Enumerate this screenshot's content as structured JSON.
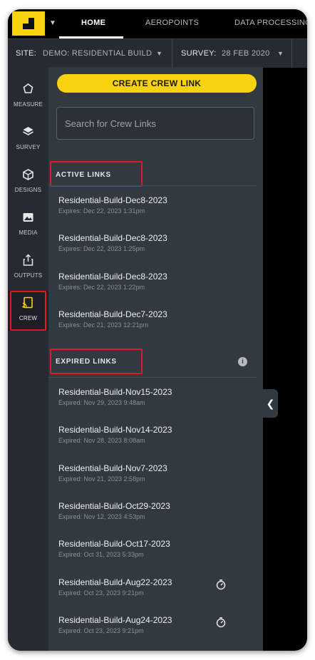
{
  "nav": {
    "tabs": [
      {
        "label": "HOME"
      },
      {
        "label": "AEROPOINTS"
      },
      {
        "label": "DATA PROCESSING"
      }
    ]
  },
  "sitebar": {
    "site_label": "SITE:",
    "site_value": "DEMO: RESIDENTIAL BUILD",
    "survey_label": "SURVEY:",
    "survey_value": "28 FEB 2020"
  },
  "rail": {
    "items": [
      {
        "label": "MEASURE",
        "icon": "measure-icon"
      },
      {
        "label": "SURVEY",
        "icon": "layers-icon"
      },
      {
        "label": "DESIGNS",
        "icon": "cube-icon"
      },
      {
        "label": "MEDIA",
        "icon": "image-icon"
      },
      {
        "label": "OUTPUTS",
        "icon": "share-icon"
      },
      {
        "label": "CREW",
        "icon": "crew-link-icon"
      }
    ],
    "active": "CREW"
  },
  "panel": {
    "create_button": "CREATE CREW LINK",
    "search_placeholder": "Search for Crew Links",
    "active_title": "ACTIVE LINKS",
    "expired_title": "EXPIRED LINKS",
    "active_links": [
      {
        "name": "Residential-Build-Dec8-2023",
        "expires": "Expires: Dec 22, 2023 1:31pm"
      },
      {
        "name": "Residential-Build-Dec8-2023",
        "expires": "Expires: Dec 22, 2023 1:25pm"
      },
      {
        "name": "Residential-Build-Dec8-2023",
        "expires": "Expires: Dec 22, 2023 1:22pm"
      },
      {
        "name": "Residential-Build-Dec7-2023",
        "expires": "Expires: Dec 21, 2023 12:21pm"
      }
    ],
    "expired_links": [
      {
        "name": "Residential-Build-Nov15-2023",
        "expires": "Expired: Nov 29, 2023 9:48am",
        "renew": false
      },
      {
        "name": "Residential-Build-Nov14-2023",
        "expires": "Expired: Nov 28, 2023 8:08am",
        "renew": false
      },
      {
        "name": "Residential-Build-Nov7-2023",
        "expires": "Expired: Nov 21, 2023 2:58pm",
        "renew": false
      },
      {
        "name": "Residential-Build-Oct29-2023",
        "expires": "Expired: Nov 12, 2023 4:53pm",
        "renew": false
      },
      {
        "name": "Residential-Build-Oct17-2023",
        "expires": "Expired: Oct 31, 2023 5:33pm",
        "renew": false
      },
      {
        "name": "Residential-Build-Aug22-2023",
        "expires": "Expired: Oct 23, 2023 9:21pm",
        "renew": true
      },
      {
        "name": "Residential-Build-Aug24-2023",
        "expires": "Expired: Oct 23, 2023 9:21pm",
        "renew": true
      }
    ]
  },
  "colors": {
    "accent": "#f6d20f",
    "highlight": "#e01a1a",
    "panel": "#333940",
    "rail": "#262b33"
  }
}
